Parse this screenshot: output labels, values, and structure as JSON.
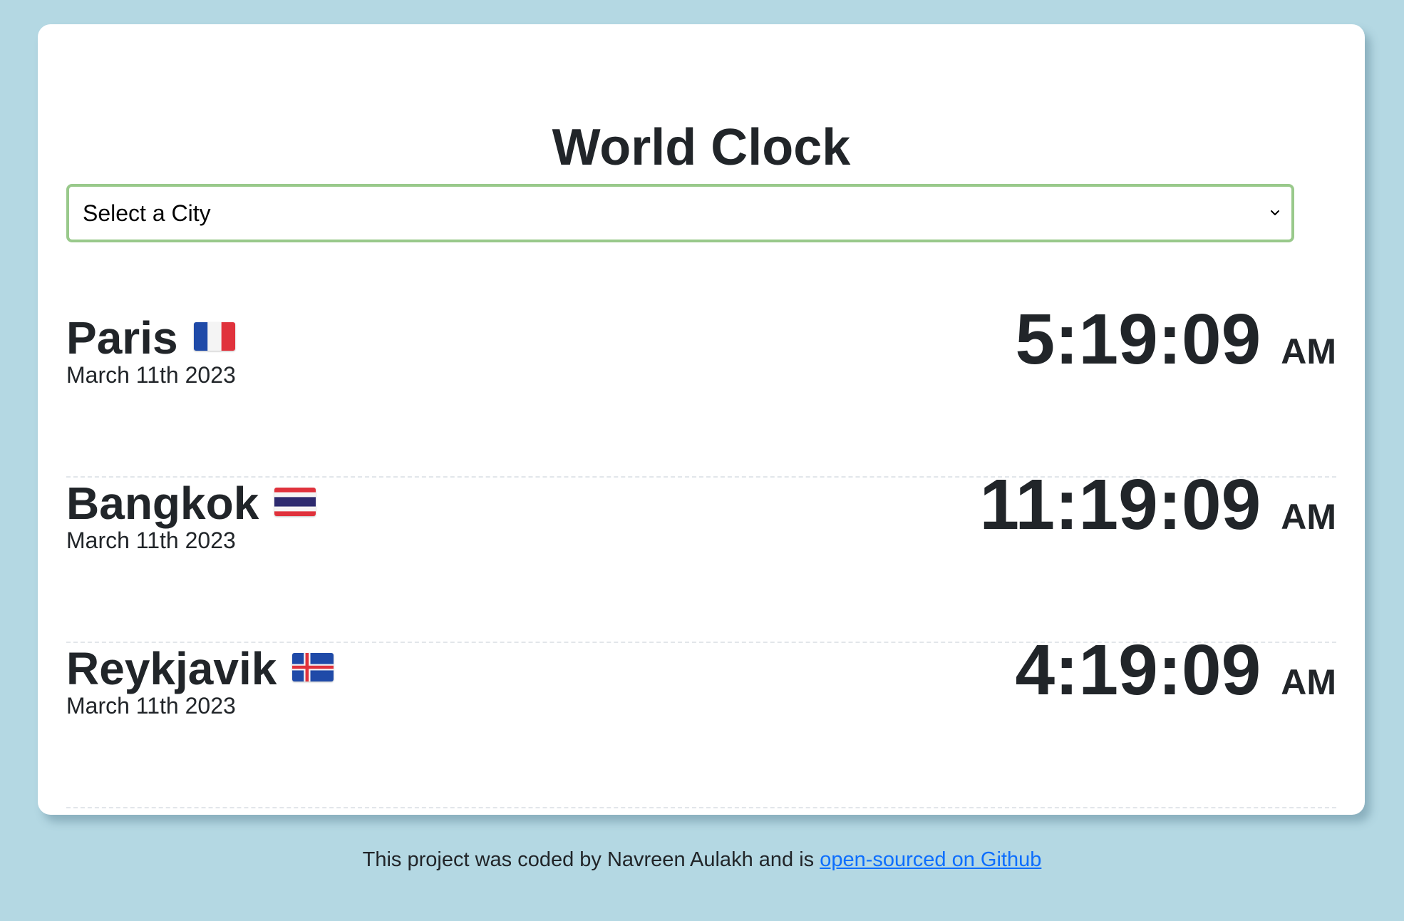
{
  "app": {
    "title": "World Clock"
  },
  "city_select": {
    "selected_label": "Select a City"
  },
  "cities": [
    {
      "name": "Paris",
      "flag": "france-flag",
      "date": "March 11th 2023",
      "time": "5:19:09",
      "ampm": "AM"
    },
    {
      "name": "Bangkok",
      "flag": "thailand-flag",
      "date": "March 11th 2023",
      "time": "11:19:09",
      "ampm": "AM"
    },
    {
      "name": "Reykjavik",
      "flag": "iceland-flag",
      "date": "March 11th 2023",
      "time": "4:19:09",
      "ampm": "AM"
    }
  ],
  "footer": {
    "text": "This project was coded by Navreen Aulakh and is ",
    "link_text": "open-sourced on Github"
  },
  "colors": {
    "background": "#b4d8e3",
    "card": "#ffffff",
    "select_border": "#99c98b",
    "text": "#212529",
    "link": "#0d6efd"
  }
}
